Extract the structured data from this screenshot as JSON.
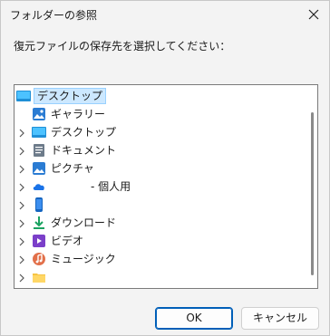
{
  "window": {
    "title": "フォルダーの参照"
  },
  "prompt": "復元ファイルの保存先を選択してください：",
  "tree": {
    "root": {
      "label": "デスクトップ",
      "icon": "desktop-icon"
    },
    "items": [
      {
        "label": "ギャラリー",
        "icon": "gallery-icon",
        "expandable": false
      },
      {
        "label": "デスクトップ",
        "icon": "desktop-icon",
        "expandable": true
      },
      {
        "label": "ドキュメント",
        "icon": "document-icon",
        "expandable": true
      },
      {
        "label": "ピクチャ",
        "icon": "picture-icon",
        "expandable": true
      },
      {
        "label": "- 個人用",
        "icon": "onedrive-icon",
        "expandable": true
      },
      {
        "label": "",
        "icon": "phone-icon",
        "expandable": true
      },
      {
        "label": "ダウンロード",
        "icon": "download-icon",
        "expandable": true
      },
      {
        "label": "ビデオ",
        "icon": "video-icon",
        "expandable": true
      },
      {
        "label": "ミュージック",
        "icon": "music-icon",
        "expandable": true
      },
      {
        "label": "",
        "icon": "folder-icon",
        "expandable": true
      }
    ]
  },
  "buttons": {
    "ok": "OK",
    "cancel": "キャンセル"
  }
}
